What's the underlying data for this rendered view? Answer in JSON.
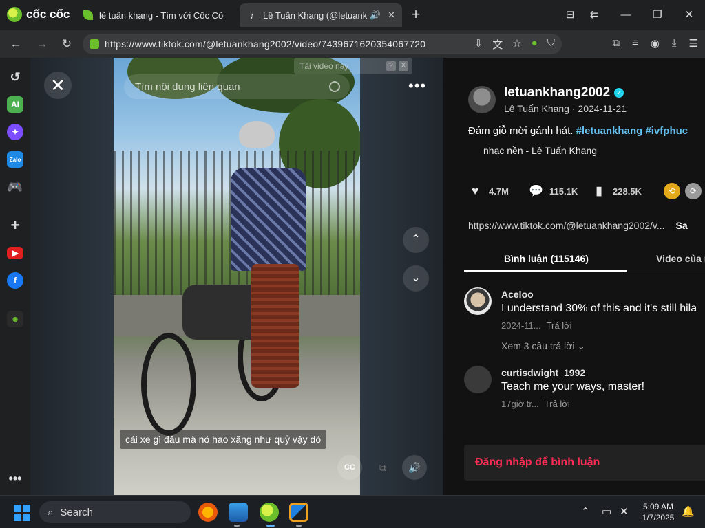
{
  "browser": {
    "brand": "cốc cốc",
    "tabs": [
      {
        "title": "lê tuấn khang - Tìm với Cốc Cốc",
        "active": false
      },
      {
        "title": "Lê Tuấn Khang (@letuank",
        "active": true
      }
    ],
    "url": "https://www.tiktok.com/@letuankhang2002/video/7439671620354067720"
  },
  "video": {
    "search_placeholder": "Tìm nội dung liên quan",
    "download_overlay": "Tải video này",
    "overlay_q1": "?",
    "overlay_q2": "X",
    "caption": "cái xe gì đâu mà nó hao xăng như quỷ vậy dó",
    "cc_label": "CC"
  },
  "panel": {
    "username": "letuankhang2002",
    "display_name_date": "Lê Tuấn Khang · 2024-11-21",
    "description_text": "Đám giỗ mời gánh hát. ",
    "tag1": "#letuankhang",
    "tag2": "#ivfphuc",
    "music": "nhạc nền - Lê Tuấn Khang",
    "likes": "4.7M",
    "comments": "115.1K",
    "saves": "228.5K",
    "link": "https://www.tiktok.com/@letuankhang2002/v...",
    "copy_label": "Sa",
    "tab_comments": "Bình luận (115146)",
    "tab_videos": "Video của n",
    "login_cta": "Đăng nhập để bình luận"
  },
  "comments": [
    {
      "user": "Aceloo",
      "text": "I understand 30% of this and it's still hila",
      "date": "2024-11...",
      "reply": "Trả lời",
      "more": "Xem 3 câu trả lời ⌄"
    },
    {
      "user": "curtisdwight_1992",
      "text": "Teach me your ways, master!",
      "date": "17giờ tr...",
      "reply": "Trả lời"
    }
  ],
  "taskbar": {
    "search": "Search",
    "time": "5:09 AM",
    "date": "1/7/2025"
  },
  "colors": {
    "accent_tag": "#63c0f0",
    "login_red": "#fe2c55",
    "coccoc_green": "#6bbf2a"
  }
}
